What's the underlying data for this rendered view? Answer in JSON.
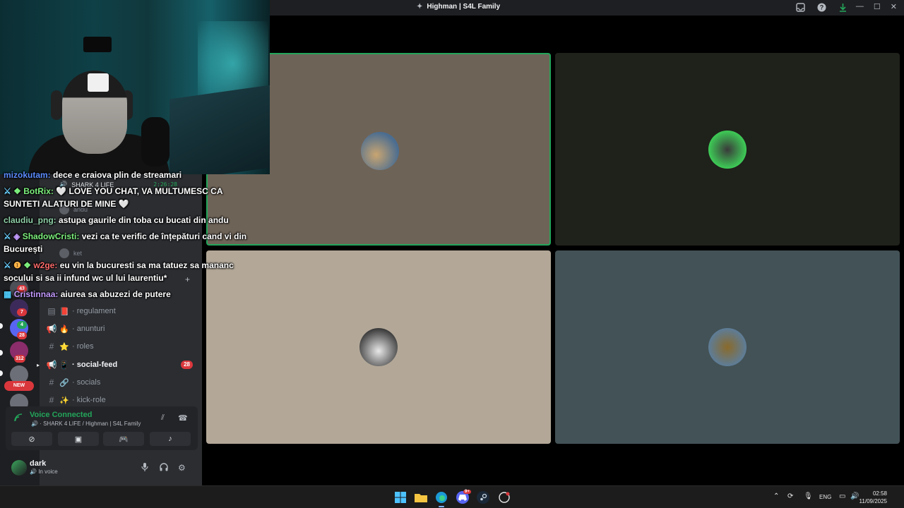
{
  "window": {
    "title": "Highman | S4L Family"
  },
  "titlebar_icons": [
    "inbox-icon",
    "help-icon",
    "download-icon"
  ],
  "window_controls": {
    "minimize": "—",
    "maximize": "☐",
    "close": "✕"
  },
  "server_badges": {
    "b1": "43",
    "b2": "7",
    "b3": "4",
    "b4": "28",
    "b5": "312",
    "new": "NEW"
  },
  "channels": [
    {
      "emoji": "📕",
      "name": "regulament",
      "type": "rules"
    },
    {
      "emoji": "🔥",
      "name": "anunturi",
      "type": "announcement"
    },
    {
      "emoji": "⭐",
      "name": "roles",
      "type": "text"
    },
    {
      "emoji": "📱",
      "name": "social-feed",
      "type": "announcement",
      "badge": "28"
    },
    {
      "emoji": "🔗",
      "name": "socials",
      "type": "text"
    },
    {
      "emoji": "✨",
      "name": "kick-role",
      "type": "text"
    }
  ],
  "voice_channel_partial": {
    "name": "SHARK 4 LIFE",
    "time": "2:26:28",
    "members": [
      "andu",
      "ket"
    ]
  },
  "voice": {
    "status": "Voice Connected",
    "location": "SHARK 4 LIFE / Highman | S4L Family"
  },
  "user": {
    "name": "dark",
    "status": "In voice"
  },
  "chat": [
    {
      "user": "mizokutam:",
      "text": "dece e craiova plin de streamari",
      "color": "#5b8cff"
    },
    {
      "user": "BotRix:",
      "text": "🤍 LOVE YOU CHAT, VA MULTUMESC CA",
      "color": "#7cf07c"
    },
    {
      "user": "",
      "text": "SUNTETI ALATURI DE MINE 🤍",
      "color": "#ffffff"
    },
    {
      "user": "claudiu_png:",
      "text": "astupa gaurile din toba cu bucati din andu",
      "color": "#8fd0a8"
    },
    {
      "user": "ShadowCristi:",
      "text": "vezi ca te verific de înțepături cand vi din",
      "color": "#7cf07c"
    },
    {
      "user": "",
      "text": "București",
      "color": "#ffffff"
    },
    {
      "user": "w2ge:",
      "text": "eu vin la bucuresti sa ma tatuez sa mananc",
      "color": "#ff6b6b"
    },
    {
      "user": "",
      "text": "socului si sa ii infund wc ul lui laurentiu*",
      "color": "#ffffff"
    },
    {
      "user": "Cristinnaa:",
      "text": "aiurea sa abuzezi de putere",
      "color": "#c39bff"
    }
  ],
  "tiles": [
    {
      "bg": "#6e6357",
      "speaking": true
    },
    {
      "bg": "#1f211b",
      "speaking": false
    },
    {
      "bg": "#b3a898",
      "speaking": false
    },
    {
      "bg": "#435256",
      "speaking": false
    }
  ],
  "taskbar": {
    "apps": [
      "windows-start-icon",
      "file-explorer-icon",
      "edge-browser-icon",
      "discord-icon",
      "steam-icon",
      "github-icon"
    ],
    "discord_badge": "9+",
    "language": "ENG",
    "time": "02:58",
    "date": "11/09/2025"
  }
}
